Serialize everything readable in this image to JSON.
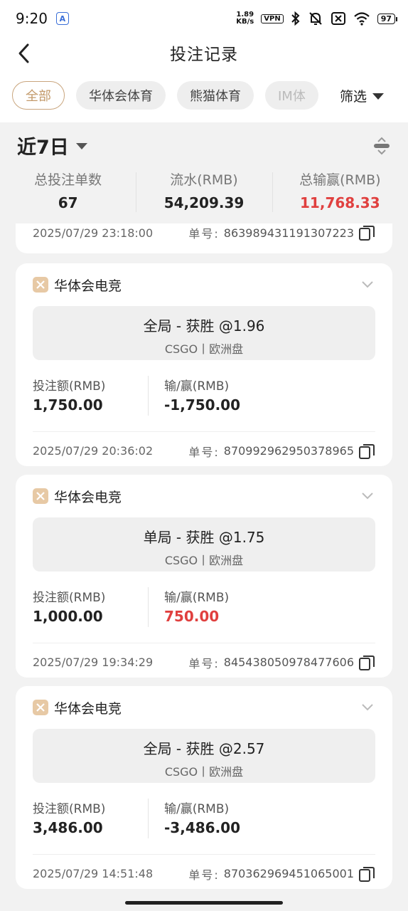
{
  "status_bar": {
    "time": "9:20",
    "net_speed_value": "1.89",
    "net_speed_unit": "KB/s",
    "vpn": "VPN",
    "battery": "97"
  },
  "header": {
    "title": "投注记录"
  },
  "tabs": [
    {
      "label": "全部",
      "active": true
    },
    {
      "label": "华体会体育",
      "active": false
    },
    {
      "label": "熊猫体育",
      "active": false
    },
    {
      "label": "IM体",
      "active": false
    }
  ],
  "filter_label": "筛选",
  "period_label": "近7日",
  "summary": {
    "count_label": "总投注单数",
    "count_value": "67",
    "turnover_label": "流水(RMB)",
    "turnover_value": "54,209.39",
    "winloss_label": "总输赢(RMB)",
    "winloss_value": "11,768.33"
  },
  "partial_record": {
    "time": "2025/07/29 23:18:00",
    "order_label": "单号:",
    "order_number": "863989431191307223"
  },
  "records": [
    {
      "platform": "华体会电竞",
      "bet_title": "全局 - 获胜 @1.96",
      "bet_sub": "CSGO丨欧洲盘",
      "stake_label": "投注额(RMB)",
      "stake_value": "1,750.00",
      "winloss_label": "输/赢(RMB)",
      "winloss_value": "-1,750.00",
      "time": "2025/07/29 20:36:02",
      "order_label": "单号:",
      "order_number": "870992962950378965"
    },
    {
      "platform": "华体会电竞",
      "bet_title": "单局 - 获胜 @1.75",
      "bet_sub": "CSGO丨欧洲盘",
      "stake_label": "投注额(RMB)",
      "stake_value": "1,000.00",
      "winloss_label": "输/赢(RMB)",
      "winloss_value": "750.00",
      "time": "2025/07/29 19:34:29",
      "order_label": "单号:",
      "order_number": "845438050978477606"
    },
    {
      "platform": "华体会电竞",
      "bet_title": "全局 - 获胜 @2.57",
      "bet_sub": "CSGO丨欧洲盘",
      "stake_label": "投注额(RMB)",
      "stake_value": "3,486.00",
      "winloss_label": "输/赢(RMB)",
      "winloss_value": "-3,486.00",
      "time": "2025/07/29 14:51:48",
      "order_label": "单号:",
      "order_number": "870362969451065001"
    }
  ],
  "colors": {
    "accent_gold": "#c39a6b",
    "win_red": "#e0403f",
    "background": "#f2f2f2"
  }
}
